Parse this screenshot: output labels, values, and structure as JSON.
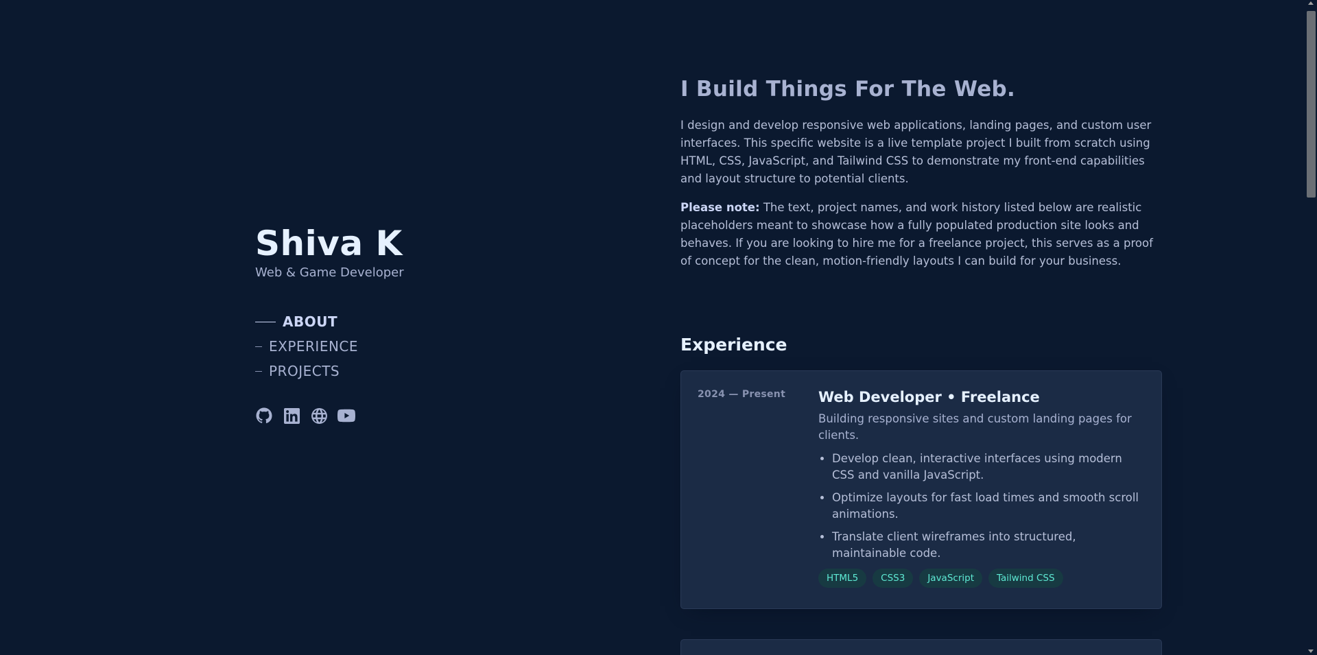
{
  "profile": {
    "name": "Shiva K",
    "role": "Web & Game Developer"
  },
  "nav": {
    "items": [
      {
        "label": "ABOUT",
        "active": true
      },
      {
        "label": "EXPERIENCE",
        "active": false
      },
      {
        "label": "PROJECTS",
        "active": false
      }
    ]
  },
  "socials": {
    "icons": [
      "github-icon",
      "linkedin-icon",
      "globe-icon",
      "youtube-icon"
    ]
  },
  "about": {
    "headline": "I Build Things For The Web.",
    "paragraph1": "I design and develop responsive web applications, landing pages, and custom user interfaces. This specific website is a live template project I built from scratch using HTML, CSS, JavaScript, and Tailwind CSS to demonstrate my front-end capabilities and layout structure to potential clients.",
    "note_label": "Please note:",
    "note_text": " The text, project names, and work history listed below are realistic placeholders meant to showcase how a fully populated production site looks and behaves. If you are looking to hire me for a freelance project, this serves as a proof of concept for the clean, motion-friendly layouts I can build for your business."
  },
  "experience": {
    "title": "Experience",
    "jobs": [
      {
        "date": "2024 — Present",
        "title": "Web Developer • Freelance",
        "description": "Building responsive sites and custom landing pages for clients.",
        "bullets": [
          "Develop clean, interactive interfaces using modern CSS and vanilla JavaScript.",
          "Optimize layouts for fast load times and smooth scroll animations.",
          "Translate client wireframes into structured, maintainable code."
        ],
        "tags": [
          "HTML5",
          "CSS3",
          "JavaScript",
          "Tailwind CSS"
        ]
      }
    ]
  },
  "colors": {
    "background": "#0b192f",
    "accent": "#5eead4",
    "heading": "#e6f1ff",
    "text": "#a8b2d1"
  }
}
